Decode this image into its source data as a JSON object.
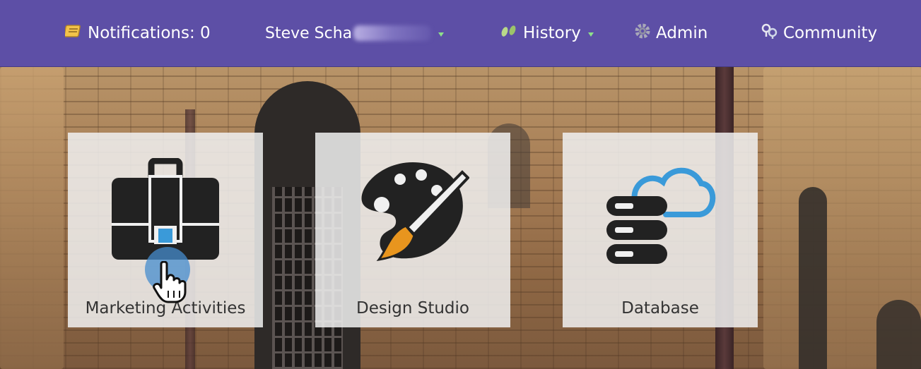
{
  "topnav": {
    "notifications_label": "Notifications: 0",
    "user_name_visible": "Steve Scha",
    "history_label": "History",
    "admin_label": "Admin",
    "community_label": "Community"
  },
  "tiles": [
    {
      "label": "Marketing Activities",
      "icon": "briefcase-icon"
    },
    {
      "label": "Design Studio",
      "icon": "paint-palette-icon"
    },
    {
      "label": "Database",
      "icon": "database-cloud-icon"
    }
  ],
  "colors": {
    "nav_bg": "#5d4fa6",
    "tile_bg": "#f0f0f0",
    "icon_dark": "#222222",
    "accent_blue": "#3a9ad9",
    "accent_orange": "#e8951e"
  }
}
